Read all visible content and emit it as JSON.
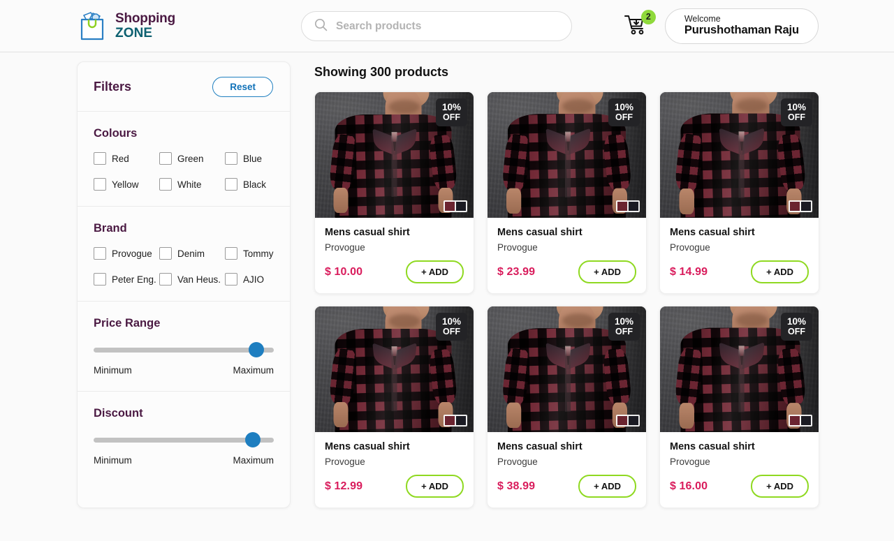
{
  "header": {
    "brand": {
      "line1": "Shopping",
      "line2": "ZONE",
      "logo_icon": "shopping-bag-icon"
    },
    "search": {
      "placeholder": "Search products",
      "value": "",
      "icon": "search-icon"
    },
    "cart": {
      "icon": "cart-icon",
      "badge_count": "2"
    },
    "user": {
      "greeting": "Welcome",
      "name": "Purushothaman Raju"
    }
  },
  "filters": {
    "title": "Filters",
    "reset_label": "Reset",
    "colours": {
      "title": "Colours",
      "options": [
        "Red",
        "Green",
        "Blue",
        "Yellow",
        "White",
        "Black"
      ]
    },
    "brand": {
      "title": "Brand",
      "options": [
        "Provogue",
        "Denim",
        "Tommy",
        "Peter Eng.",
        "Van Heus.",
        "AJIO"
      ]
    },
    "price_range": {
      "title": "Price Range",
      "min_label": "Minimum",
      "max_label": "Maximum",
      "value_pct": 94
    },
    "discount": {
      "title": "Discount",
      "min_label": "Minimum",
      "max_label": "Maximum",
      "value_pct": 92
    }
  },
  "main": {
    "showing": "Showing 300 products",
    "products": [
      {
        "name": "Mens casual shirt",
        "brand": "Provogue",
        "price": "$ 10.00",
        "discount_pct": "10%",
        "discount_off": "OFF",
        "add_label": "+ ADD",
        "swatches": [
          "#6b2430",
          "#1b1b23"
        ]
      },
      {
        "name": "Mens casual shirt",
        "brand": "Provogue",
        "price": "$ 23.99",
        "discount_pct": "10%",
        "discount_off": "OFF",
        "add_label": "+ ADD",
        "swatches": [
          "#6b2430",
          "#1b1b23"
        ]
      },
      {
        "name": "Mens casual shirt",
        "brand": "Provogue",
        "price": "$ 14.99",
        "discount_pct": "10%",
        "discount_off": "OFF",
        "add_label": "+ ADD",
        "swatches": [
          "#6b2430",
          "#1b1b23"
        ]
      },
      {
        "name": "Mens casual shirt",
        "brand": "Provogue",
        "price": "$ 12.99",
        "discount_pct": "10%",
        "discount_off": "OFF",
        "add_label": "+ ADD",
        "swatches": [
          "#6b2430",
          "#1b1b23"
        ]
      },
      {
        "name": "Mens casual shirt",
        "brand": "Provogue",
        "price": "$ 38.99",
        "discount_pct": "10%",
        "discount_off": "OFF",
        "add_label": "+ ADD",
        "swatches": [
          "#6b2430",
          "#1b1b23"
        ]
      },
      {
        "name": "Mens casual shirt",
        "brand": "Provogue",
        "price": "$ 16.00",
        "discount_pct": "10%",
        "discount_off": "OFF",
        "add_label": "+ ADD",
        "swatches": [
          "#6b2430",
          "#1b1b23"
        ]
      }
    ]
  },
  "colors": {
    "brand_purple": "#4a1942",
    "brand_teal": "#0d6070",
    "accent_green": "#8fd921",
    "price_pink": "#d91c5c",
    "link_blue": "#1071b8",
    "slider_blue": "#1e7ec0",
    "badge_dark": "#232326",
    "page_bg": "#fafafa"
  }
}
